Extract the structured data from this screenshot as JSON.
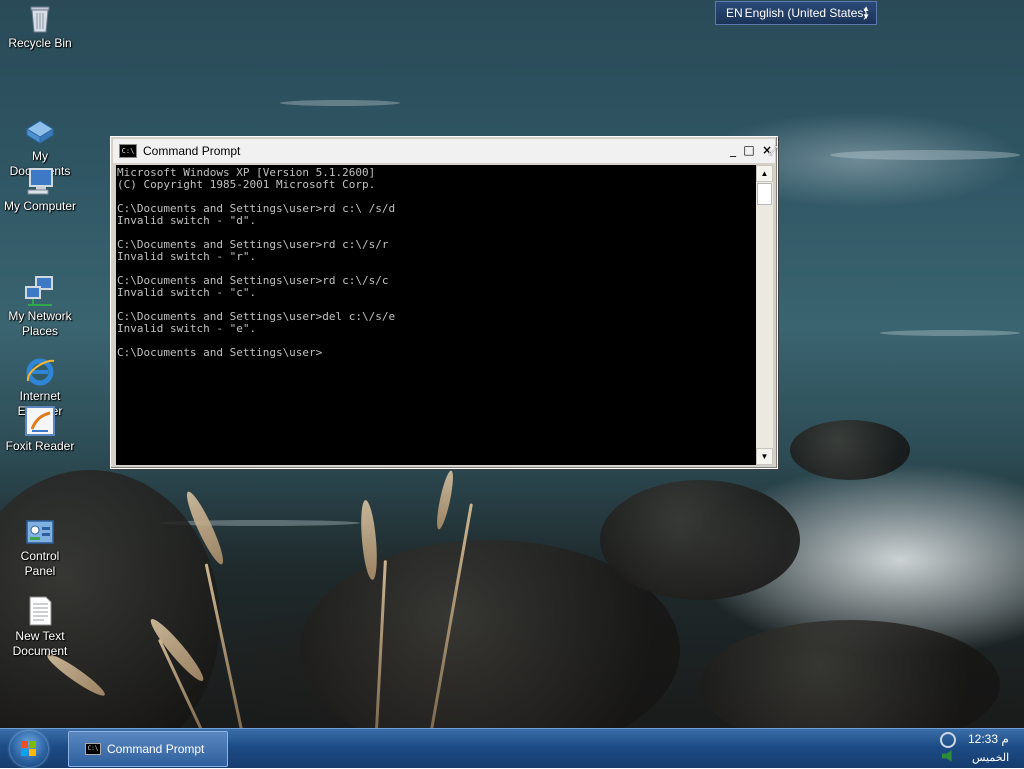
{
  "desktop": {
    "icons": [
      {
        "label": "Recycle Bin",
        "icon": "recycle-bin-icon"
      },
      {
        "label": "My\nDocuments",
        "icon": "my-documents-icon"
      },
      {
        "label": "My Computer",
        "icon": "my-computer-icon"
      },
      {
        "label": "My Network\nPlaces",
        "icon": "network-places-icon"
      },
      {
        "label": "Internet\nExplorer",
        "icon": "internet-explorer-icon"
      },
      {
        "label": "Foxit Reader",
        "icon": "foxit-reader-icon"
      },
      {
        "label": "Control\nPanel",
        "icon": "control-panel-icon"
      },
      {
        "label": "New Text\nDocument",
        "icon": "text-document-icon"
      }
    ]
  },
  "language_bar": {
    "code": "EN",
    "language": "English (United States)"
  },
  "cmd_window": {
    "title": "Command Prompt",
    "icon_text": "C:\\",
    "buttons": {
      "minimize": "_",
      "maximize": "□",
      "close": "×"
    },
    "lines": [
      "Microsoft Windows XP [Version 5.1.2600]",
      "(C) Copyright 1985-2001 Microsoft Corp.",
      "",
      "C:\\Documents and Settings\\user>rd c:\\ /s/d",
      "Invalid switch - \"d\".",
      "",
      "C:\\Documents and Settings\\user>rd c:\\/s/r",
      "Invalid switch - \"r\".",
      "",
      "C:\\Documents and Settings\\user>rd c:\\/s/c",
      "Invalid switch - \"c\".",
      "",
      "C:\\Documents and Settings\\user>del c:\\/s/e",
      "Invalid switch - \"e\".",
      "",
      "C:\\Documents and Settings\\user>"
    ]
  },
  "taskbar": {
    "task_label": "Command Prompt",
    "task_icon_text": "C:\\",
    "clock_time": "12:33 م",
    "clock_day": "الخميس"
  },
  "colors": {
    "console_bg": "#000000",
    "console_fg": "#c0c0c0",
    "taskbar": "#1d4c86",
    "titlebar": "#f1f1f1"
  }
}
